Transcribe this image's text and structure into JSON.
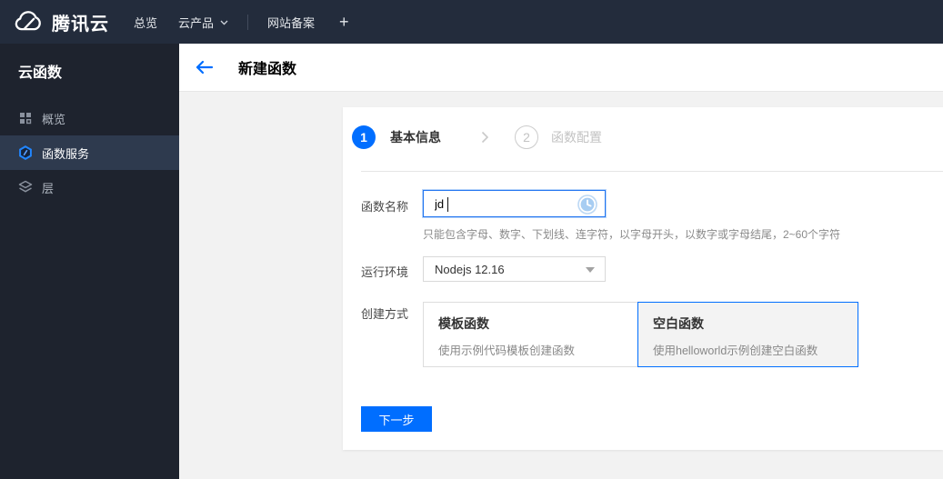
{
  "topbar": {
    "brand": "腾讯云",
    "nav": [
      {
        "label": "总览"
      },
      {
        "label": "云产品"
      },
      {
        "label": "网站备案"
      },
      {
        "label": "+"
      }
    ]
  },
  "sidebar": {
    "title": "云函数",
    "items": [
      {
        "label": "概览"
      },
      {
        "label": "函数服务"
      },
      {
        "label": "层"
      }
    ]
  },
  "header": {
    "title": "新建函数"
  },
  "steps": [
    {
      "number": "1",
      "label": "基本信息"
    },
    {
      "number": "2",
      "label": "函数配置"
    }
  ],
  "form": {
    "name_label": "函数名称",
    "name_value": "jd",
    "name_hint": "只能包含字母、数字、下划线、连字符，以字母开头，以数字或字母结尾，2~60个字符",
    "runtime_label": "运行环境",
    "runtime_value": "Nodejs 12.16",
    "method_label": "创建方式",
    "options": [
      {
        "title": "模板函数",
        "desc": "使用示例代码模板创建函数"
      },
      {
        "title": "空白函数",
        "desc": "使用helloworld示例创建空白函数"
      }
    ],
    "next_label": "下一步"
  },
  "colors": {
    "accent": "#006eff",
    "topbar_bg": "#232c3c",
    "sidebar_bg": "#1e232e",
    "sidebar_active_bg": "#2e3a4e",
    "content_bg": "#f2f2f2",
    "inactive_step": "#c3c3c3"
  }
}
